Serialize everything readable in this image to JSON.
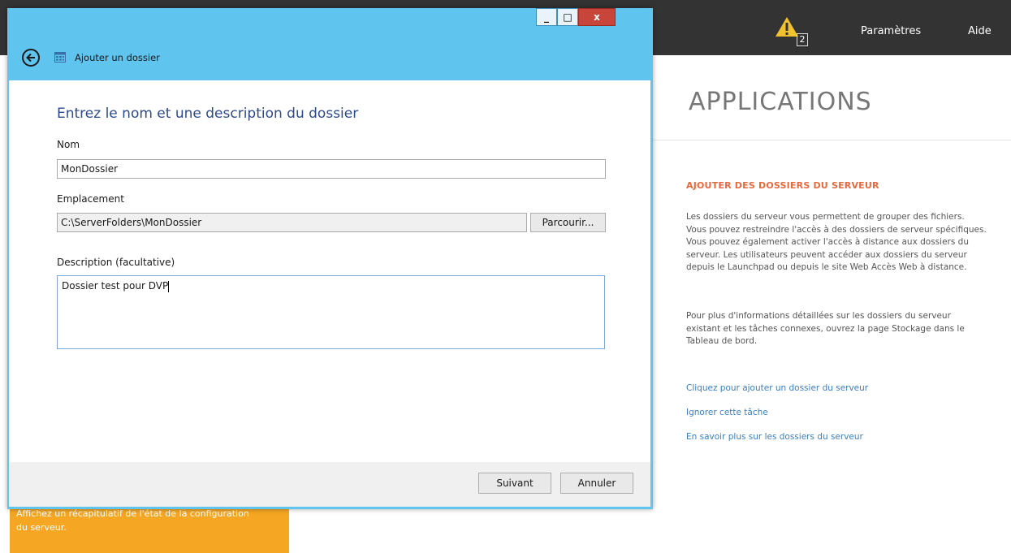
{
  "header": {
    "notification_count": "2",
    "settings_label": "Paramètres",
    "help_label": "Aide"
  },
  "right_panel": {
    "title": "APPLICATIONS",
    "task_title": "AJOUTER DES DOSSIERS DU SERVEUR",
    "paragraph1": "Les dossiers du serveur vous permettent de grouper des fichiers. Vous pouvez restreindre l'accès à des dossiers de serveur spécifiques. Vous pouvez également activer l'accès à distance aux dossiers du serveur. Les utilisateurs peuvent accéder aux dossiers du serveur depuis le Launchpad ou depuis le site Web Accès Web à distance.",
    "paragraph2": "Pour plus d'informations détaillées sur les dossiers du serveur existant et les tâches connexes, ouvrez la page Stockage dans le Tableau de bord.",
    "links": [
      "Cliquez pour ajouter un dossier du serveur",
      "Ignorer cette tâche",
      "En savoir plus sur les dossiers du serveur"
    ]
  },
  "background_tile": {
    "text": "Affichez un récapitulatif de l'état de la configuration du serveur."
  },
  "dialog": {
    "caption_buttons": {
      "minimize": "_",
      "maximize": "□",
      "close": "x"
    },
    "nav_title": "Ajouter un dossier",
    "heading": "Entrez le nom et une description du dossier",
    "name_label": "Nom",
    "name_value": "MonDossier",
    "location_label": "Emplacement",
    "location_value": "C:\\ServerFolders\\MonDossier",
    "browse_label": "Parcourir...",
    "description_label": "Description (facultative)",
    "description_value": "Dossier test pour DVP",
    "next_label": "Suivant",
    "cancel_label": "Annuler"
  },
  "colors": {
    "window_frame": "#5fc4ee",
    "topbar": "#333333",
    "task_title": "#e8693b",
    "link": "#3a7fc1",
    "heading": "#2e4a8b",
    "orange_tile": "#f5a623"
  }
}
